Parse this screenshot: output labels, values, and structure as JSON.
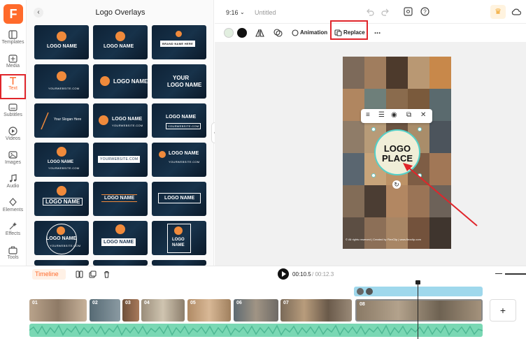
{
  "brand": {
    "logo_letter": "F",
    "accent": "#ff6a2b",
    "highlight": "#e0252b"
  },
  "rail": [
    {
      "label": "Templates",
      "icon": "templates-icon"
    },
    {
      "label": "Media",
      "icon": "media-icon"
    },
    {
      "label": "Text",
      "icon": "text-icon",
      "active": true
    },
    {
      "label": "Subtitles",
      "icon": "subtitles-icon"
    },
    {
      "label": "Videos",
      "icon": "videos-icon"
    },
    {
      "label": "Images",
      "icon": "images-icon"
    },
    {
      "label": "Audio",
      "icon": "audio-icon"
    },
    {
      "label": "Elements",
      "icon": "elements-icon"
    },
    {
      "label": "Effects",
      "icon": "effects-icon"
    },
    {
      "label": "Tools",
      "icon": "tools-icon"
    }
  ],
  "panel": {
    "title": "Logo Overlays",
    "thumbs": {
      "t1": "LOGO NAME",
      "t2": "BRAND NAME HERE",
      "t3": "YOURWEBSITE.COM",
      "t4": "LOGO NAME",
      "t5a": "YOUR",
      "t5b": "LOGO NAME",
      "t6": "Your Slogan Here",
      "t7": "LOGO NAME",
      "t8": "LOGO NAME",
      "t8b": "YOURWEBSITE.COM",
      "t9": "LOGO NAME",
      "t9b": "YOURWEBSITE.COM",
      "t10": "YOURWEBSITE.COM",
      "t11": "LOGO NAME",
      "t11b": "YOURWEBSITE.COM",
      "t12": "LOGO NAME",
      "t12b": "YOURWEBSITE.COM",
      "t13": "LOGO NAME",
      "t14": "LOGO NAME",
      "t15": "LOGO NAME",
      "t16": "LOGO NAME",
      "t16b": "YOURWEBSITE.COM",
      "t17": "LOGO NAME",
      "t18a": "LOGO",
      "t18b": "NAME"
    }
  },
  "topbar": {
    "ratio": "9:16",
    "title": "Untitled"
  },
  "toolbar": {
    "animation_label": "Animation",
    "replace_label": "Replace",
    "more_label": "..."
  },
  "canvas": {
    "logo_line1": "LOGO",
    "logo_line2": "PLACE",
    "footer": "© All rights reserved | Created by FlexClip | www.flexclip.com"
  },
  "timeline": {
    "label": "Timeline",
    "current_time": "00:10.5",
    "total_time": "/ 00:12.3",
    "clips": [
      "01",
      "02",
      "03",
      "04",
      "05",
      "06",
      "07",
      "08"
    ],
    "add_label": "+"
  }
}
